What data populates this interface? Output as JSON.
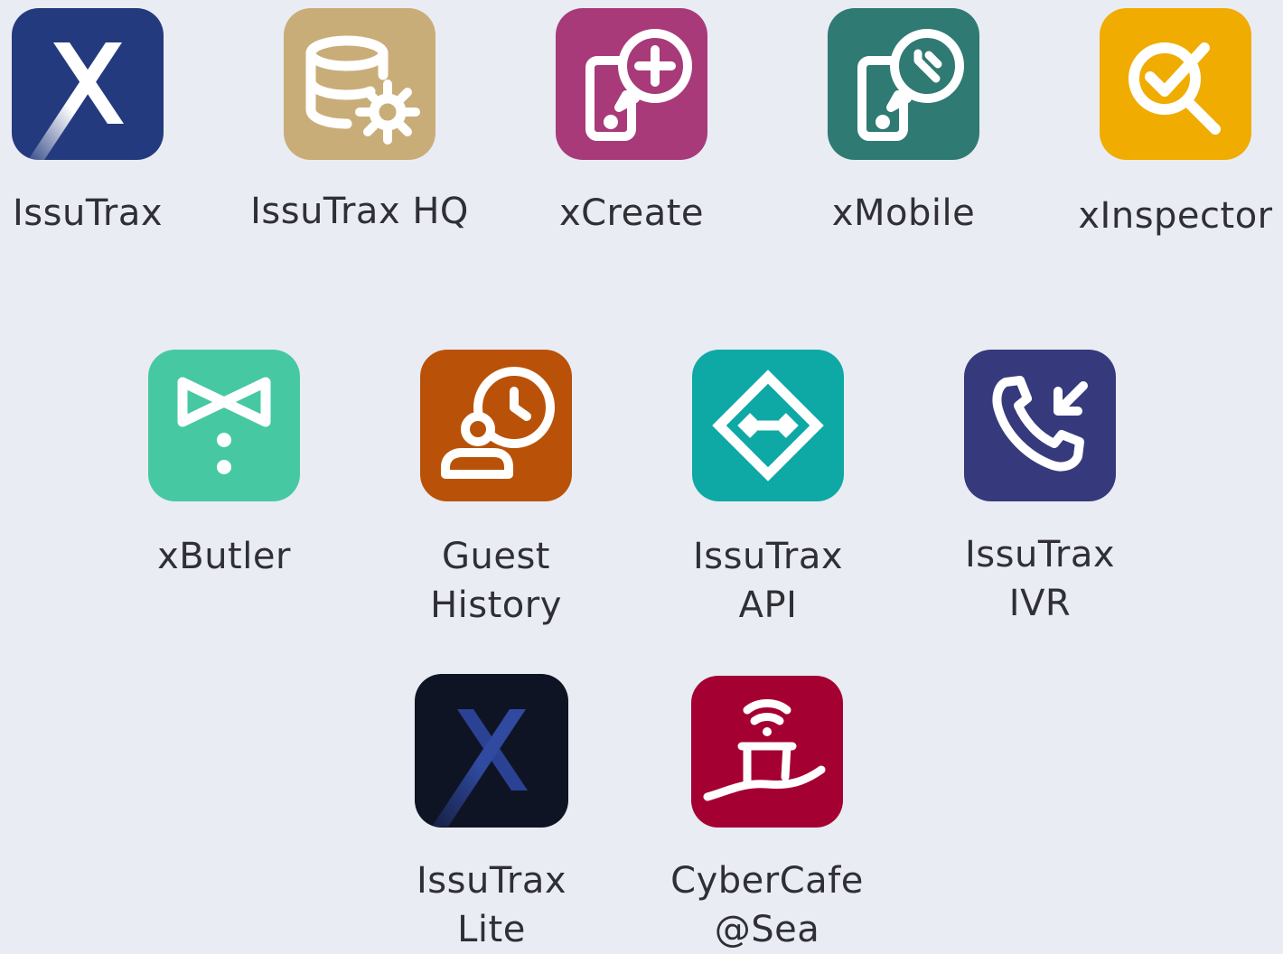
{
  "apps": [
    {
      "id": "issutrax",
      "lines": [
        "IssuTrax"
      ],
      "color": "#233a7e",
      "icon": "x-logo-icon"
    },
    {
      "id": "issutrax-hq",
      "lines": [
        "IssuTrax HQ"
      ],
      "color": "#c9ad78",
      "icon": "database-gear-icon"
    },
    {
      "id": "xcreate",
      "lines": [
        "xCreate"
      ],
      "color": "#a83a79",
      "icon": "phone-add-icon"
    },
    {
      "id": "xmobile",
      "lines": [
        "xMobile"
      ],
      "color": "#2f7a73",
      "icon": "phone-wrench-icon"
    },
    {
      "id": "xinspector",
      "lines": [
        "xInspector"
      ],
      "color": "#f0ac00",
      "icon": "search-check-icon"
    },
    {
      "id": "xbutler",
      "lines": [
        "xButler"
      ],
      "color": "#46c8a3",
      "icon": "bowtie-icon"
    },
    {
      "id": "guest-history",
      "lines": [
        "Guest",
        "History"
      ],
      "color": "#b95208",
      "icon": "person-clock-icon"
    },
    {
      "id": "issutrax-api",
      "lines": [
        "IssuTrax",
        "API"
      ],
      "color": "#0ea8a5",
      "icon": "diamond-arrows-icon"
    },
    {
      "id": "issutrax-ivr",
      "lines": [
        "IssuTrax",
        "IVR"
      ],
      "color": "#363a7d",
      "icon": "phone-incoming-icon"
    },
    {
      "id": "issutrax-lite",
      "lines": [
        "IssuTrax",
        "Lite"
      ],
      "color": "#0f1425",
      "icon": "x-logo-dark-icon"
    },
    {
      "id": "cybercafe",
      "lines": [
        "CyberCafe",
        "@Sea"
      ],
      "color": "#a50032",
      "icon": "ship-wifi-icon"
    }
  ]
}
